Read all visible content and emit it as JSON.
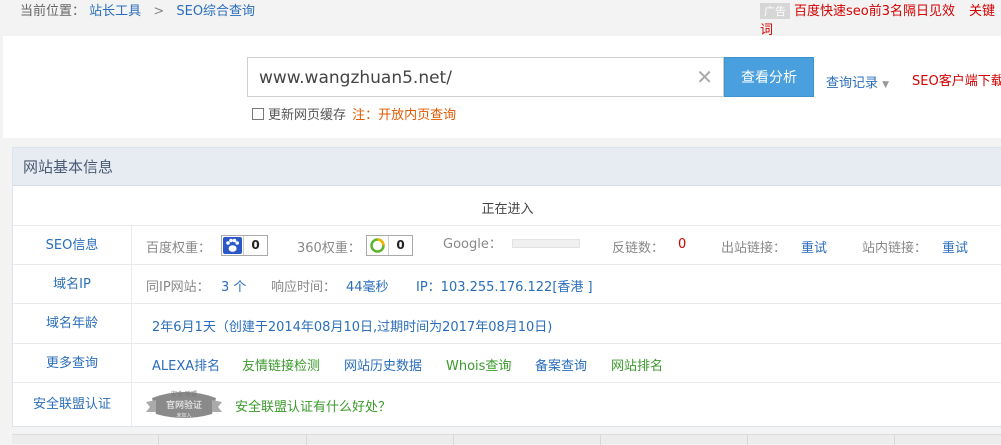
{
  "breadcrumb": {
    "label": "当前位置：",
    "items": [
      "站长工具",
      "SEO综合查询"
    ],
    "separator": ">"
  },
  "ad": {
    "tag": "广告",
    "link_text": "百度快速seo前3名隔日见效",
    "link_text_2": "关键词"
  },
  "search": {
    "value": "www.wangzhuan5.net/",
    "clear_symbol": "✕",
    "button_label": "查看分析",
    "history_label": "查询记录",
    "client_download": "SEO客户端下载",
    "cache_checkbox_label": "更新网页缓存",
    "note_prefix": "注：",
    "note_link": "开放内页查询"
  },
  "info": {
    "title": "网站基本信息",
    "status": "正在进入",
    "seo_row": {
      "label": "SEO信息",
      "baidu_label": "百度权重：",
      "baidu_value": "0",
      "so360_label": "360权重：",
      "so360_value": "0",
      "google_label": "Google：",
      "backlinks_label": "反链数：",
      "backlinks_value": "0",
      "outlinks_label": "出站链接：",
      "outlinks_value": "重试",
      "inlinks_label": "站内链接：",
      "inlinks_value": "重试"
    },
    "ip_row": {
      "label": "域名IP",
      "same_ip_label": "同IP网站：",
      "same_ip_value": "3 个",
      "response_label": "响应时间：",
      "response_value": "44毫秒",
      "ip_value": "IP：103.255.176.122[香港 ]"
    },
    "age_row": {
      "label": "域名年龄",
      "value": "2年6月1天（创建于2014年08月10日,过期时间为2017年08月10日)"
    },
    "more_row": {
      "label": "更多查询",
      "links": [
        "ALEXA排名",
        "友情链接检测",
        "网站历史数据",
        "Whois查询",
        "备案查询",
        "网站排名"
      ]
    },
    "security_row": {
      "label": "安全联盟认证",
      "seal_text": "官网验证",
      "seal_top": "安全 联盟",
      "seal_bottom": "未加入",
      "question": "安全联盟认证有什么好处？"
    }
  },
  "colors": {
    "accent_blue": "#4a9fde",
    "link_blue": "#2a6ebb",
    "alert_red": "#d40000",
    "green": "#3a9a2a",
    "header_bg": "#e7ecf3"
  }
}
